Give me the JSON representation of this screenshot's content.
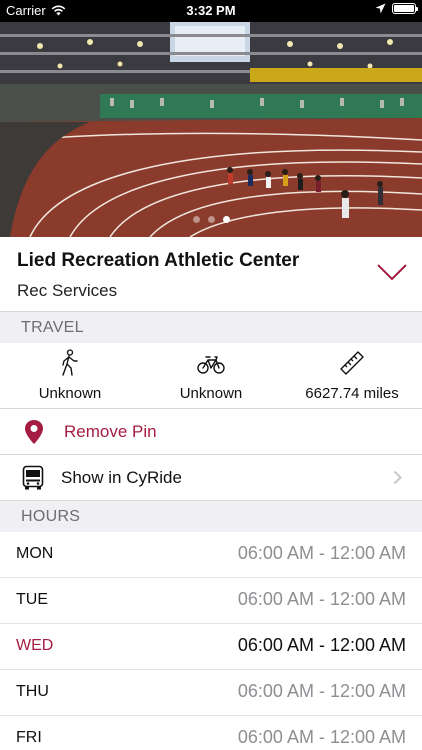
{
  "status_bar": {
    "carrier": "Carrier",
    "time": "3:32 PM"
  },
  "hero": {
    "pages": 3,
    "active_page": 3
  },
  "place": {
    "title": "Lied Recreation Athletic Center",
    "subtitle": "Rec Services"
  },
  "travel": {
    "header": "TRAVEL",
    "walk": {
      "icon": "walking-person-icon",
      "value": "Unknown"
    },
    "bike": {
      "icon": "bicycle-icon",
      "value": "Unknown"
    },
    "distance": {
      "icon": "ruler-icon",
      "value": "6627.74 miles"
    }
  },
  "actions": {
    "remove_pin": "Remove Pin",
    "show_cyride": "Show in CyRide"
  },
  "hours": {
    "header": "HOURS",
    "days": [
      {
        "day": "MON",
        "hours": "06:00 AM - 12:00 AM",
        "today": false
      },
      {
        "day": "TUE",
        "hours": "06:00 AM - 12:00 AM",
        "today": false
      },
      {
        "day": "WED",
        "hours": "06:00 AM - 12:00 AM",
        "today": true
      },
      {
        "day": "THU",
        "hours": "06:00 AM - 12:00 AM",
        "today": false
      },
      {
        "day": "FRI",
        "hours": "06:00 AM - 12:00 AM",
        "today": false
      }
    ]
  },
  "colors": {
    "accent": "#a51c42",
    "section_bg": "#efeff4",
    "section_text": "#6d6d72"
  }
}
